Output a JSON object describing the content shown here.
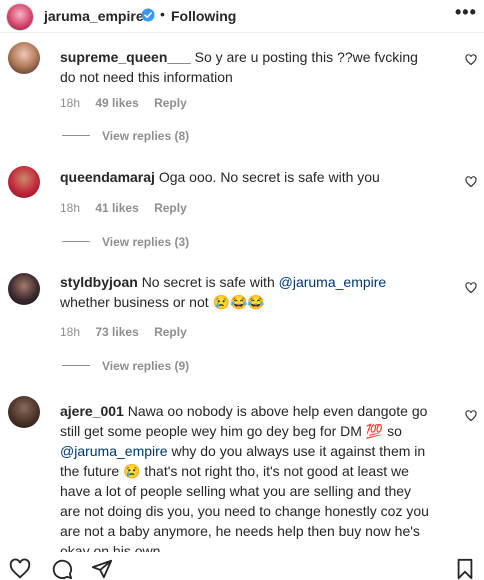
{
  "header": {
    "username": "jaruma_empire",
    "separator": "•",
    "follow_status": "Following",
    "more_label": "•••"
  },
  "comments": [
    {
      "username": "supreme_queen___",
      "text": "So y are u posting this ??we fvcking do not need this information",
      "time": "18h",
      "likes": "49 likes",
      "reply": "Reply",
      "view_replies": "View replies (8)"
    },
    {
      "username": "queendamaraj",
      "text": "Oga ooo. No secret is safe with you",
      "time": "18h",
      "likes": "41 likes",
      "reply": "Reply",
      "view_replies": "View replies (3)"
    },
    {
      "username": "styldbyjoan",
      "text_before": "No secret is safe with ",
      "mention": "@jaruma_empire",
      "text_after": " whether business or not 😢😂😂",
      "time": "18h",
      "likes": "73 likes",
      "reply": "Reply",
      "view_replies": "View replies (9)"
    },
    {
      "username": "ajere_001",
      "text_before": "Nawa oo nobody is above help even dangote go still get some people wey him go dey beg for DM 💯 so ",
      "mention": "@jaruma_empire",
      "text_after": " why do you always use it against them in the future 😢 that's not right tho, it's not good at least we have a lot of people selling what you are selling and they are not doing dis you, you need to change honestly coz you are not a baby anymore, he needs help then buy now he's okay on his own"
    }
  ],
  "colors": {
    "text": "#262626",
    "secondary": "#8e8e8e",
    "mention": "#00376b",
    "verified": "#3897f0"
  },
  "icons": [
    "heart-icon",
    "comment-icon",
    "share-icon",
    "bookmark-icon",
    "verified-badge-icon",
    "more-options-icon"
  ]
}
